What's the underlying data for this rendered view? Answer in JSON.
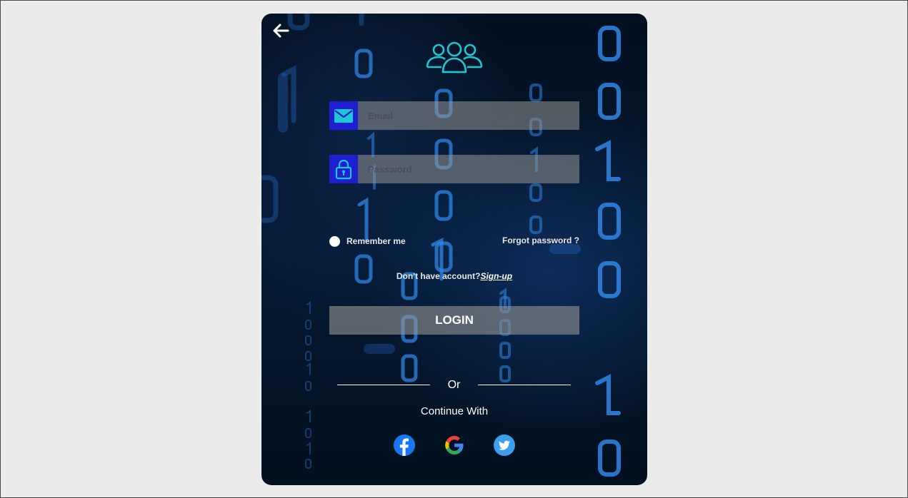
{
  "form": {
    "email_placeholder": "Email",
    "password_placeholder": "Password",
    "remember_label": "Remember me",
    "forgot_label": "Forgot password ?",
    "signup_prompt": "Don't have account?",
    "signup_link": "Sign-up",
    "login_label": "LOGIN"
  },
  "social": {
    "or_label": "Or",
    "continue_label": "Continue With",
    "providers": [
      "facebook-icon",
      "google-icon",
      "twitter-icon"
    ]
  },
  "colors": {
    "icon_box": "#1e1ed2",
    "logo": "#1fc7d4",
    "page_bg": "#ebebeb",
    "card_bg": "#041a33",
    "facebook": "#1877f2",
    "twitter": "#1da1f2"
  },
  "icons": {
    "back": "back-arrow-icon",
    "logo": "users-group-icon",
    "email": "envelope-icon",
    "password": "lock-icon"
  }
}
